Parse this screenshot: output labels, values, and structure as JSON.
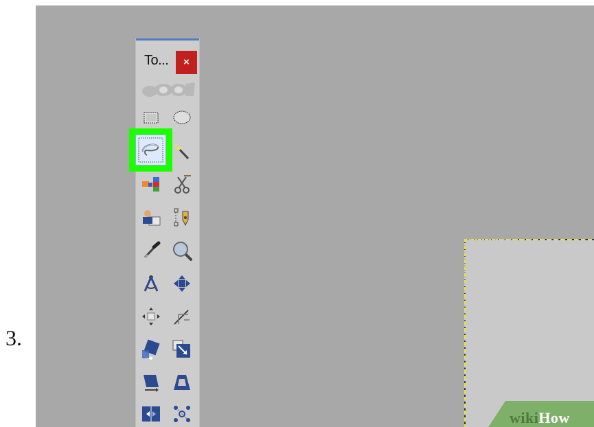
{
  "step": {
    "number": "3."
  },
  "toolbox": {
    "title": "To...",
    "close_label": "×",
    "tools": [
      {
        "id": "rect-select",
        "icon": "rectangle-select-icon"
      },
      {
        "id": "ellipse-select",
        "icon": "ellipse-select-icon"
      },
      {
        "id": "free-select",
        "icon": "lasso-icon",
        "selected": true
      },
      {
        "id": "fuzzy-select",
        "icon": "magic-wand-icon"
      },
      {
        "id": "select-by-color",
        "icon": "color-select-icon"
      },
      {
        "id": "scissors-select",
        "icon": "scissors-icon"
      },
      {
        "id": "foreground-select",
        "icon": "foreground-select-icon"
      },
      {
        "id": "paths",
        "icon": "paths-pen-icon"
      },
      {
        "id": "color-picker",
        "icon": "eyedropper-icon"
      },
      {
        "id": "zoom",
        "icon": "magnifier-icon"
      },
      {
        "id": "measure",
        "icon": "compass-icon"
      },
      {
        "id": "move",
        "icon": "move-arrows-icon"
      },
      {
        "id": "align",
        "icon": "align-icon"
      },
      {
        "id": "crop",
        "icon": "crop-knife-icon"
      },
      {
        "id": "rotate",
        "icon": "rotate-icon"
      },
      {
        "id": "scale",
        "icon": "scale-icon"
      },
      {
        "id": "shear",
        "icon": "shear-icon"
      },
      {
        "id": "perspective",
        "icon": "perspective-icon"
      },
      {
        "id": "flip",
        "icon": "flip-icon"
      },
      {
        "id": "cage",
        "icon": "cage-transform-icon"
      }
    ],
    "highlight_color": "#1cff00",
    "close_color": "#c2201f"
  },
  "watermark": {
    "wiki": "wiki",
    "how": "How"
  }
}
